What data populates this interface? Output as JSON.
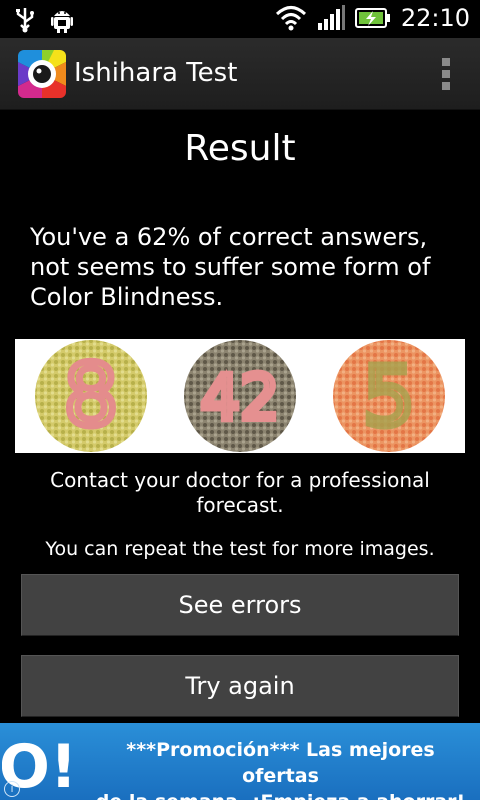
{
  "status_bar": {
    "time": "22:10",
    "icons": [
      "usb-icon",
      "android-debug-icon",
      "wifi-icon",
      "signal-icon",
      "battery-charging-icon"
    ]
  },
  "action_bar": {
    "title": "Ishihara Test",
    "app_icon": "color-wheel-eye-icon",
    "menu_icon": "overflow-menu-icon"
  },
  "content": {
    "title": "Result",
    "message": "You've a 62% of correct answers, not seems to suffer some form of Color Blindness.",
    "correct_percent": 62,
    "plates": [
      {
        "number": "8",
        "palette": "yellow-green with pink figure"
      },
      {
        "number": "42",
        "palette": "gray-brown with pink figure"
      },
      {
        "number": "5",
        "palette": "orange with green figure"
      }
    ],
    "contact_text": "Contact your doctor for a professional forecast.",
    "repeat_text": "You can repeat the test for more images."
  },
  "buttons": {
    "see_errors": "See errors",
    "try_again": "Try again"
  },
  "ad": {
    "logo_text": "O!",
    "line1": "***Promoción*** Las mejores ofertas",
    "line2": "de la semana. ¡Empieza a ahorrar!",
    "info_icon": "i"
  },
  "colors": {
    "background": "#000000",
    "action_bar": "#262626",
    "button": "#424242",
    "ad_banner": "#1f7fcf"
  }
}
